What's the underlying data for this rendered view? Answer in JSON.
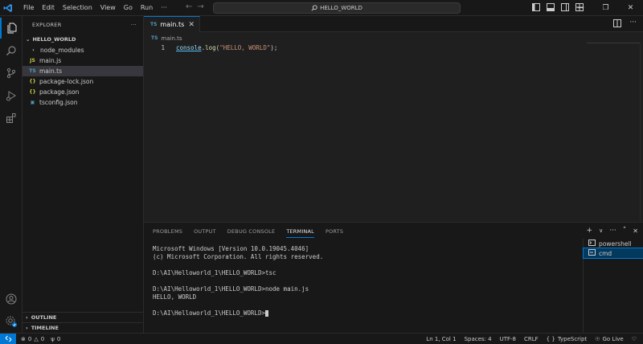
{
  "titlebar": {
    "menus": [
      "File",
      "Edit",
      "Selection",
      "View",
      "Go",
      "Run",
      "···"
    ],
    "search_text": "HELLO_WORLD",
    "colors": {
      "accent": "#0078d4"
    }
  },
  "activitybar": {
    "icons": [
      "explorer-icon",
      "search-icon",
      "source-control-icon",
      "run-debug-icon",
      "extensions-icon",
      "account-icon",
      "settings-icon"
    ]
  },
  "sidebar": {
    "title": "EXPLORER",
    "more": "···",
    "folder": "HELLO_WORLD",
    "items": [
      {
        "label": "node_modules",
        "icon": "›",
        "icon_color": "#cccccc"
      },
      {
        "label": "main.js",
        "icon": "JS",
        "icon_color": "#cbcb41"
      },
      {
        "label": "main.ts",
        "icon": "TS",
        "icon_color": "#519aba"
      },
      {
        "label": "package-lock.json",
        "icon": "{}",
        "icon_color": "#cbcb41"
      },
      {
        "label": "package.json",
        "icon": "{}",
        "icon_color": "#cbcb41"
      },
      {
        "label": "tsconfig.json",
        "icon": "▣",
        "icon_color": "#519aba"
      }
    ],
    "outline": "OUTLINE",
    "timeline": "TIMELINE"
  },
  "editor": {
    "tab": {
      "icon": "TS",
      "label": "main.ts"
    },
    "breadcrumb": {
      "icon": "TS",
      "file": "main.ts"
    },
    "line_number": "1",
    "code": {
      "obj": "console",
      "dot": ".",
      "fn": "log",
      "open": "(",
      "str": "\"HELLO, WORLD\"",
      "close": ");"
    }
  },
  "panel": {
    "tabs": [
      "PROBLEMS",
      "OUTPUT",
      "DEBUG CONSOLE",
      "TERMINAL",
      "PORTS"
    ],
    "active_tab": "TERMINAL",
    "actions": [
      "+",
      "∨",
      "···",
      "˄",
      "✕"
    ],
    "terminal_lines": [
      "Microsoft Windows [Version 10.0.19045.4046]",
      "(c) Microsoft Corporation. All rights reserved.",
      "",
      "D:\\AI\\Helloworld_1\\HELLO_WORLD>tsc",
      "",
      "D:\\AI\\Helloworld_1\\HELLO_WORLD>node main.js",
      "HELLO, WORLD",
      "",
      "D:\\AI\\Helloworld_1\\HELLO_WORLD>"
    ],
    "terminals": [
      {
        "label": "powershell"
      },
      {
        "label": "cmd"
      }
    ]
  },
  "statusbar": {
    "errors": "0",
    "warnings": "0",
    "ports": "0",
    "position": "Ln 1, Col 1",
    "spaces": "Spaces: 4",
    "encoding": "UTF-8",
    "eol": "CRLF",
    "braces": "{ }",
    "language": "TypeScript",
    "golive": "Go Live"
  }
}
